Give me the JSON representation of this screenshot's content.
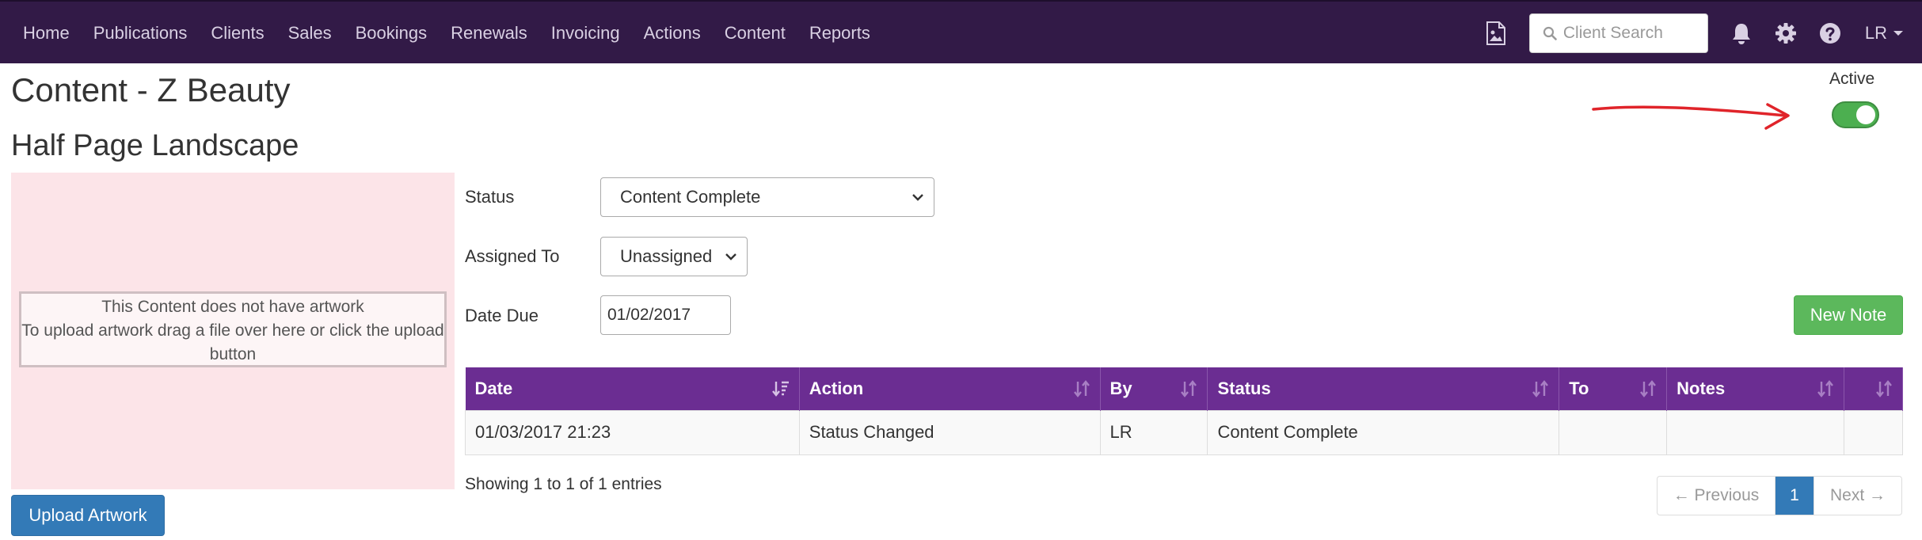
{
  "nav": {
    "items": [
      {
        "label": "Home"
      },
      {
        "label": "Publications"
      },
      {
        "label": "Clients"
      },
      {
        "label": "Sales"
      },
      {
        "label": "Bookings"
      },
      {
        "label": "Renewals"
      },
      {
        "label": "Invoicing"
      },
      {
        "label": "Actions"
      },
      {
        "label": "Content"
      },
      {
        "label": "Reports"
      }
    ],
    "search_placeholder": "Client Search",
    "user_initials": "LR"
  },
  "page": {
    "title": "Content - Z Beauty",
    "section_title": "Half Page Landscape",
    "active_label": "Active",
    "active_on": true
  },
  "artwork": {
    "line1": "This Content does not have artwork",
    "line2": "To upload artwork drag a file over here or click the upload button",
    "upload_button": "Upload Artwork"
  },
  "form": {
    "status_label": "Status",
    "status_value": "Content Complete",
    "assigned_label": "Assigned To",
    "assigned_value": "Unassigned",
    "date_label": "Date Due",
    "date_value": "01/02/2017",
    "new_note_button": "New Note"
  },
  "table": {
    "columns": [
      "Date",
      "Action",
      "By",
      "Status",
      "To",
      "Notes",
      ""
    ],
    "rows": [
      [
        "01/03/2017 21:23",
        "Status Changed",
        "LR",
        "Content Complete",
        "",
        "",
        ""
      ]
    ]
  },
  "footer": {
    "entries_info": "Showing 1 to 1 of 1 entries",
    "prev": "← Previous",
    "page": "1",
    "next": "Next →"
  },
  "colors": {
    "navbar": "#321a47",
    "table_header": "#6b2d92",
    "toggle_on": "#4caf50",
    "primary": "#337ab7",
    "success": "#5cb85c"
  }
}
